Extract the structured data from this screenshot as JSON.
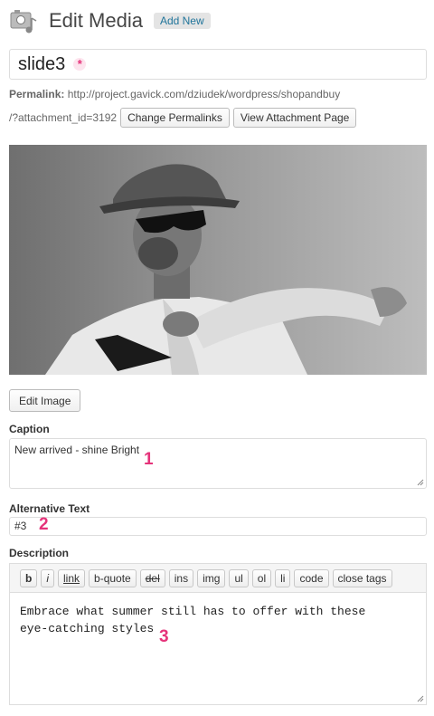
{
  "header": {
    "title": "Edit Media",
    "add_new": "Add New"
  },
  "title_field": {
    "value": "slide3"
  },
  "permalink": {
    "label": "Permalink:",
    "url_line1": "http://project.gavick.com/dziudek/wordpress/shopandbuy",
    "url_line2": "/?attachment_id=3192",
    "change_button": "Change Permalinks",
    "view_button": "View Attachment Page"
  },
  "edit_image_button": "Edit Image",
  "caption": {
    "label": "Caption",
    "value": "New arrived - shine Bright"
  },
  "alt_text": {
    "label": "Alternative Text",
    "value": "#3"
  },
  "description": {
    "label": "Description",
    "toolbar": [
      "b",
      "i",
      "link",
      "b-quote",
      "del",
      "ins",
      "img",
      "ul",
      "ol",
      "li",
      "code",
      "close tags"
    ],
    "line1": "Embrace what summer still has to offer with these",
    "line2": "eye-catching styles"
  },
  "markers": {
    "one": "1",
    "two": "2",
    "three": "3",
    "asterisk": "*"
  },
  "colors": {
    "marker": "#e5337a",
    "link": "#21759b"
  }
}
